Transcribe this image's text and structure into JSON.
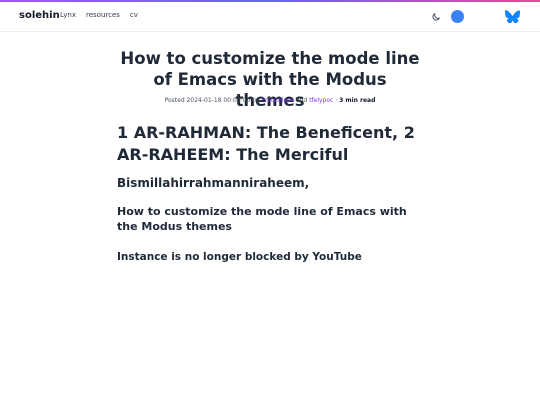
{
  "nav": {
    "brand": "solehin",
    "links": [
      "Lynx",
      "resources",
      "cv"
    ],
    "icons": [
      "moon-icon",
      "chat-icon",
      "butterfly-icon"
    ],
    "accent_colors": {
      "chat": "#3b82f6",
      "butterfly": "#1185fe",
      "author_link": "#7c3aed"
    }
  },
  "post": {
    "title": "How to customize the mode line of Emacs with the Modus themes",
    "meta": {
      "posted_label": "Posted",
      "date": "2024-01-18 00:00:00",
      "by": "by",
      "author1": "Protesilaos",
      "and": "and",
      "author2": "tfelypoc",
      "sep": "·",
      "reading_time": "3 min read"
    },
    "headings": {
      "h1": "1 AR-RAHMAN: The Beneficent, 2 AR-RAHEEM: The Merciful",
      "h2a": "Bismillahirrahmanniraheem,",
      "h2b": "How to customize the mode line of Emacs with the Modus themes",
      "h2c": "Instance is no longer blocked by YouTube"
    }
  }
}
